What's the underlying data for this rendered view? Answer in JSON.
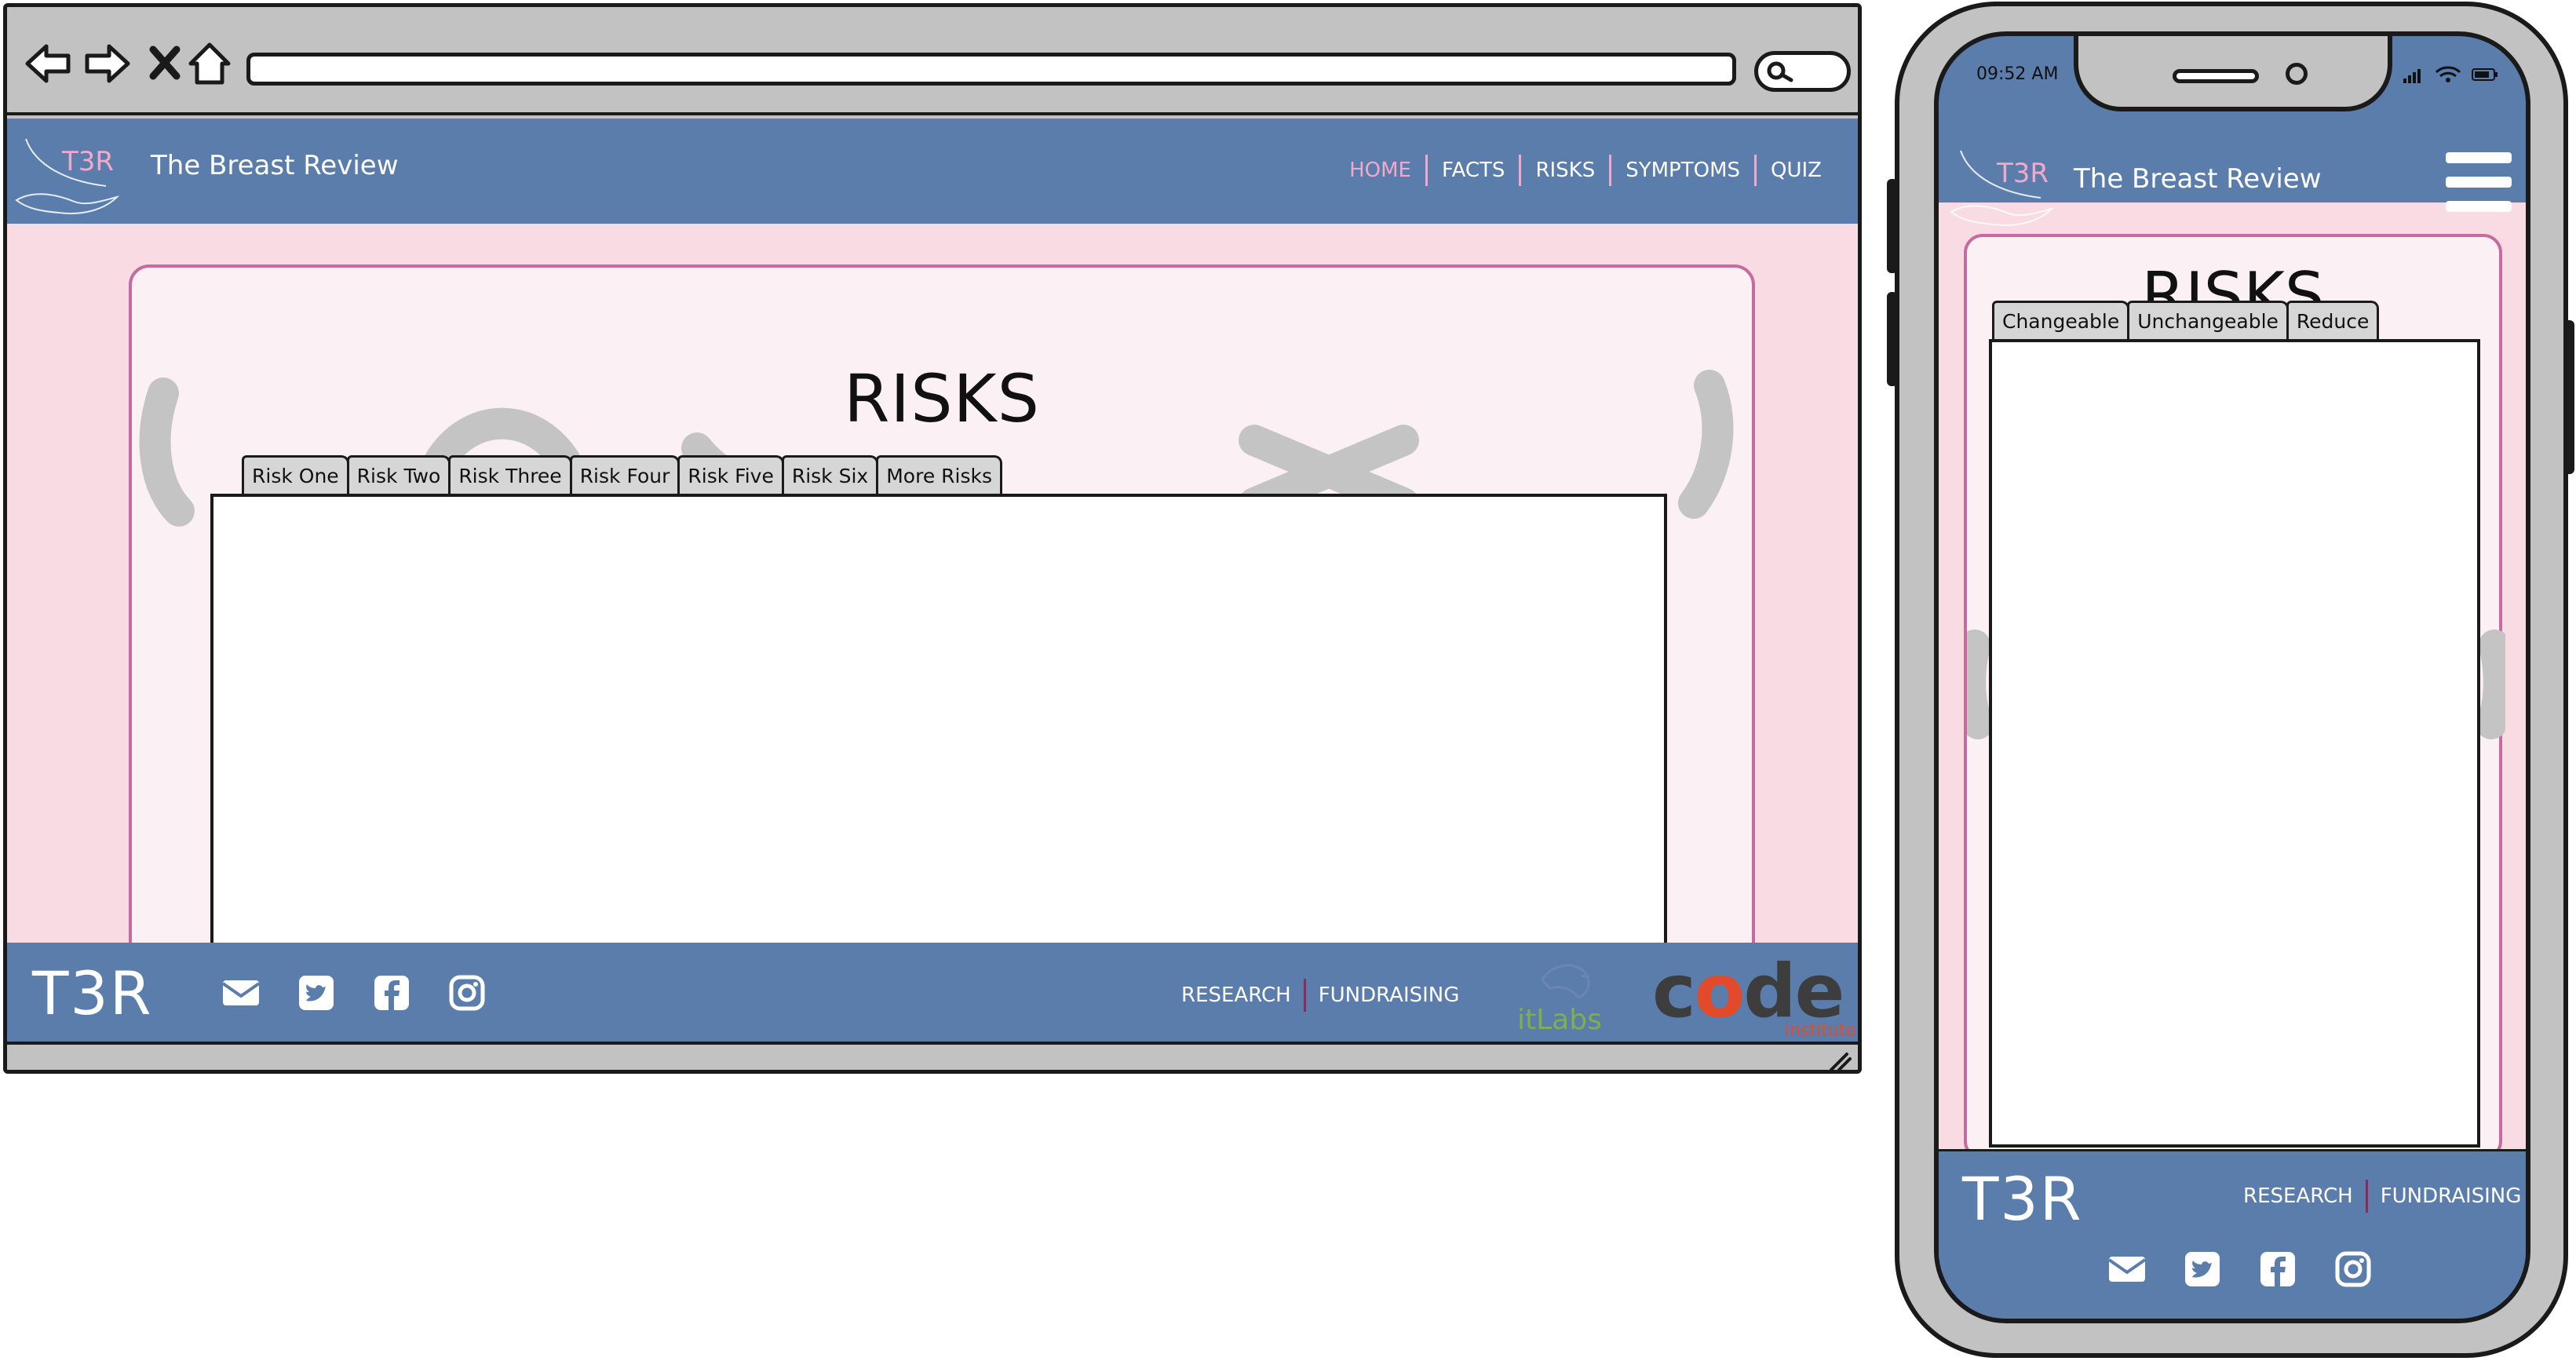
{
  "desktop": {
    "site_title": "The Breast Review",
    "nav": [
      {
        "label": "HOME",
        "active": true
      },
      {
        "label": "FACTS",
        "active": false
      },
      {
        "label": "RISKS",
        "active": false
      },
      {
        "label": "SYMPTOMS",
        "active": false
      },
      {
        "label": "QUIZ",
        "active": false
      }
    ],
    "heading": "RISKS",
    "tabs": [
      "Risk One",
      "Risk Two",
      "Risk Three",
      "Risk Four",
      "Risk Five",
      "Risk Six",
      "More Risks"
    ],
    "footer": {
      "brand": "T3R",
      "links": [
        "RESEARCH",
        "FUNDRAISING"
      ],
      "partner_logo": "itLabs",
      "code_logo": "code",
      "code_logo_sub": "institute"
    }
  },
  "mobile": {
    "time": "09:52 AM",
    "site_title": "The Breast Review",
    "heading": "RISKS",
    "tabs": [
      "Changeable",
      "Unchangeable",
      "Reduce"
    ],
    "footer": {
      "brand": "T3R",
      "links": [
        "RESEARCH",
        "FUNDRAISING"
      ]
    }
  },
  "logo_text": "T3R",
  "icons": {
    "browser": [
      "back-arrow-icon",
      "forward-arrow-icon",
      "close-icon",
      "home-icon",
      "search-icon"
    ],
    "social": [
      "envelope-icon",
      "twitter-icon",
      "facebook-icon",
      "instagram-icon"
    ]
  },
  "colors": {
    "header_blue": "#5b7dab",
    "page_pink": "#f9dbe3",
    "card_border": "#c56b9e",
    "active_nav": "#f2a9c8",
    "code_orange": "#e24a2a"
  }
}
